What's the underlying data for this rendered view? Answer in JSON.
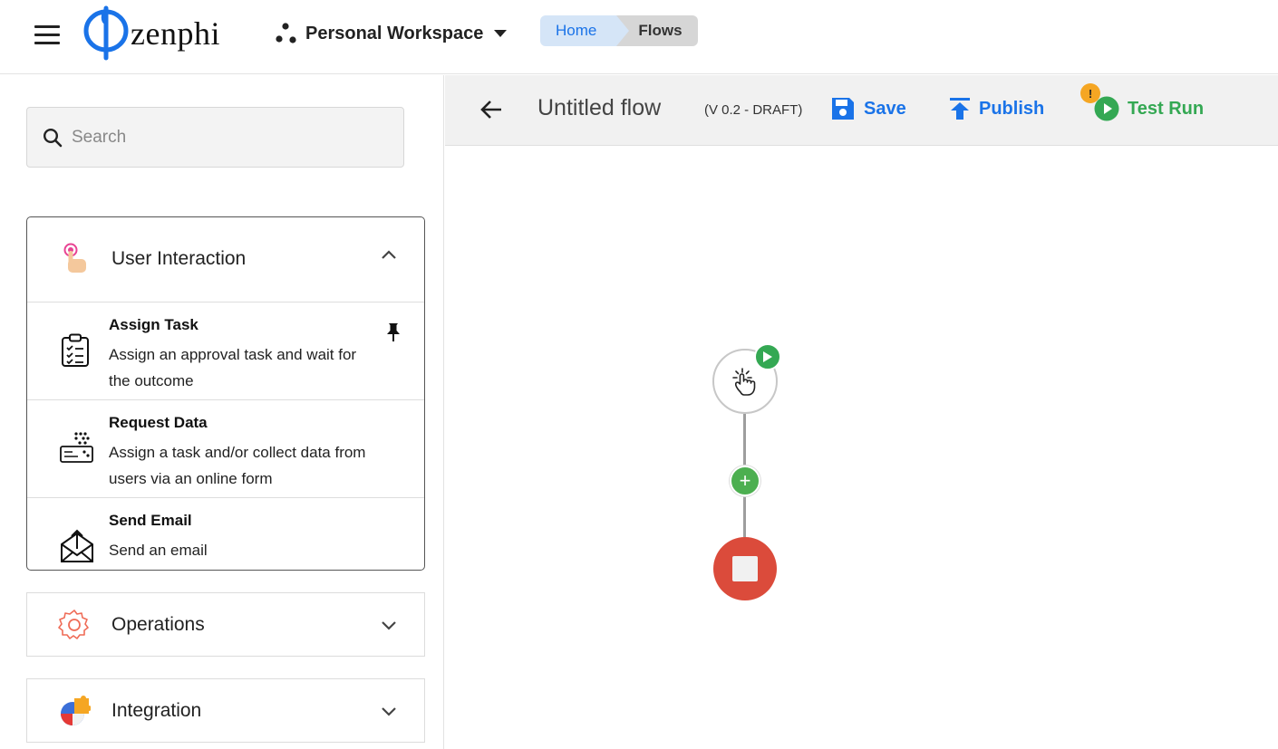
{
  "app": {
    "logo_text": "zenphi"
  },
  "workspace": {
    "label": "Personal Workspace"
  },
  "breadcrumb": {
    "home": "Home",
    "flows": "Flows"
  },
  "sidebar": {
    "search": {
      "placeholder": "Search",
      "value": ""
    },
    "groups": [
      {
        "label": "User Interaction",
        "expanded": true,
        "items": [
          {
            "title": "Assign Task",
            "description": "Assign an approval task and wait for the outcome",
            "pinned": true
          },
          {
            "title": "Request Data",
            "description": "Assign a task and/or collect data from users via an online form"
          },
          {
            "title": "Send Email",
            "description": "Send an email"
          }
        ]
      },
      {
        "label": "Operations",
        "expanded": false
      },
      {
        "label": "Integration",
        "expanded": false
      }
    ]
  },
  "flow": {
    "title": "Untitled flow",
    "version": "(V 0.2 - DRAFT)",
    "save_label": "Save",
    "publish_label": "Publish",
    "test_run_label": "Test Run",
    "warning_badge": "!"
  },
  "canvas": {
    "add_label": "+"
  },
  "colors": {
    "accent_blue": "#1a73e8",
    "accent_green": "#34a853",
    "stop_red": "#db4b3b",
    "warning_orange": "#f5a623"
  }
}
